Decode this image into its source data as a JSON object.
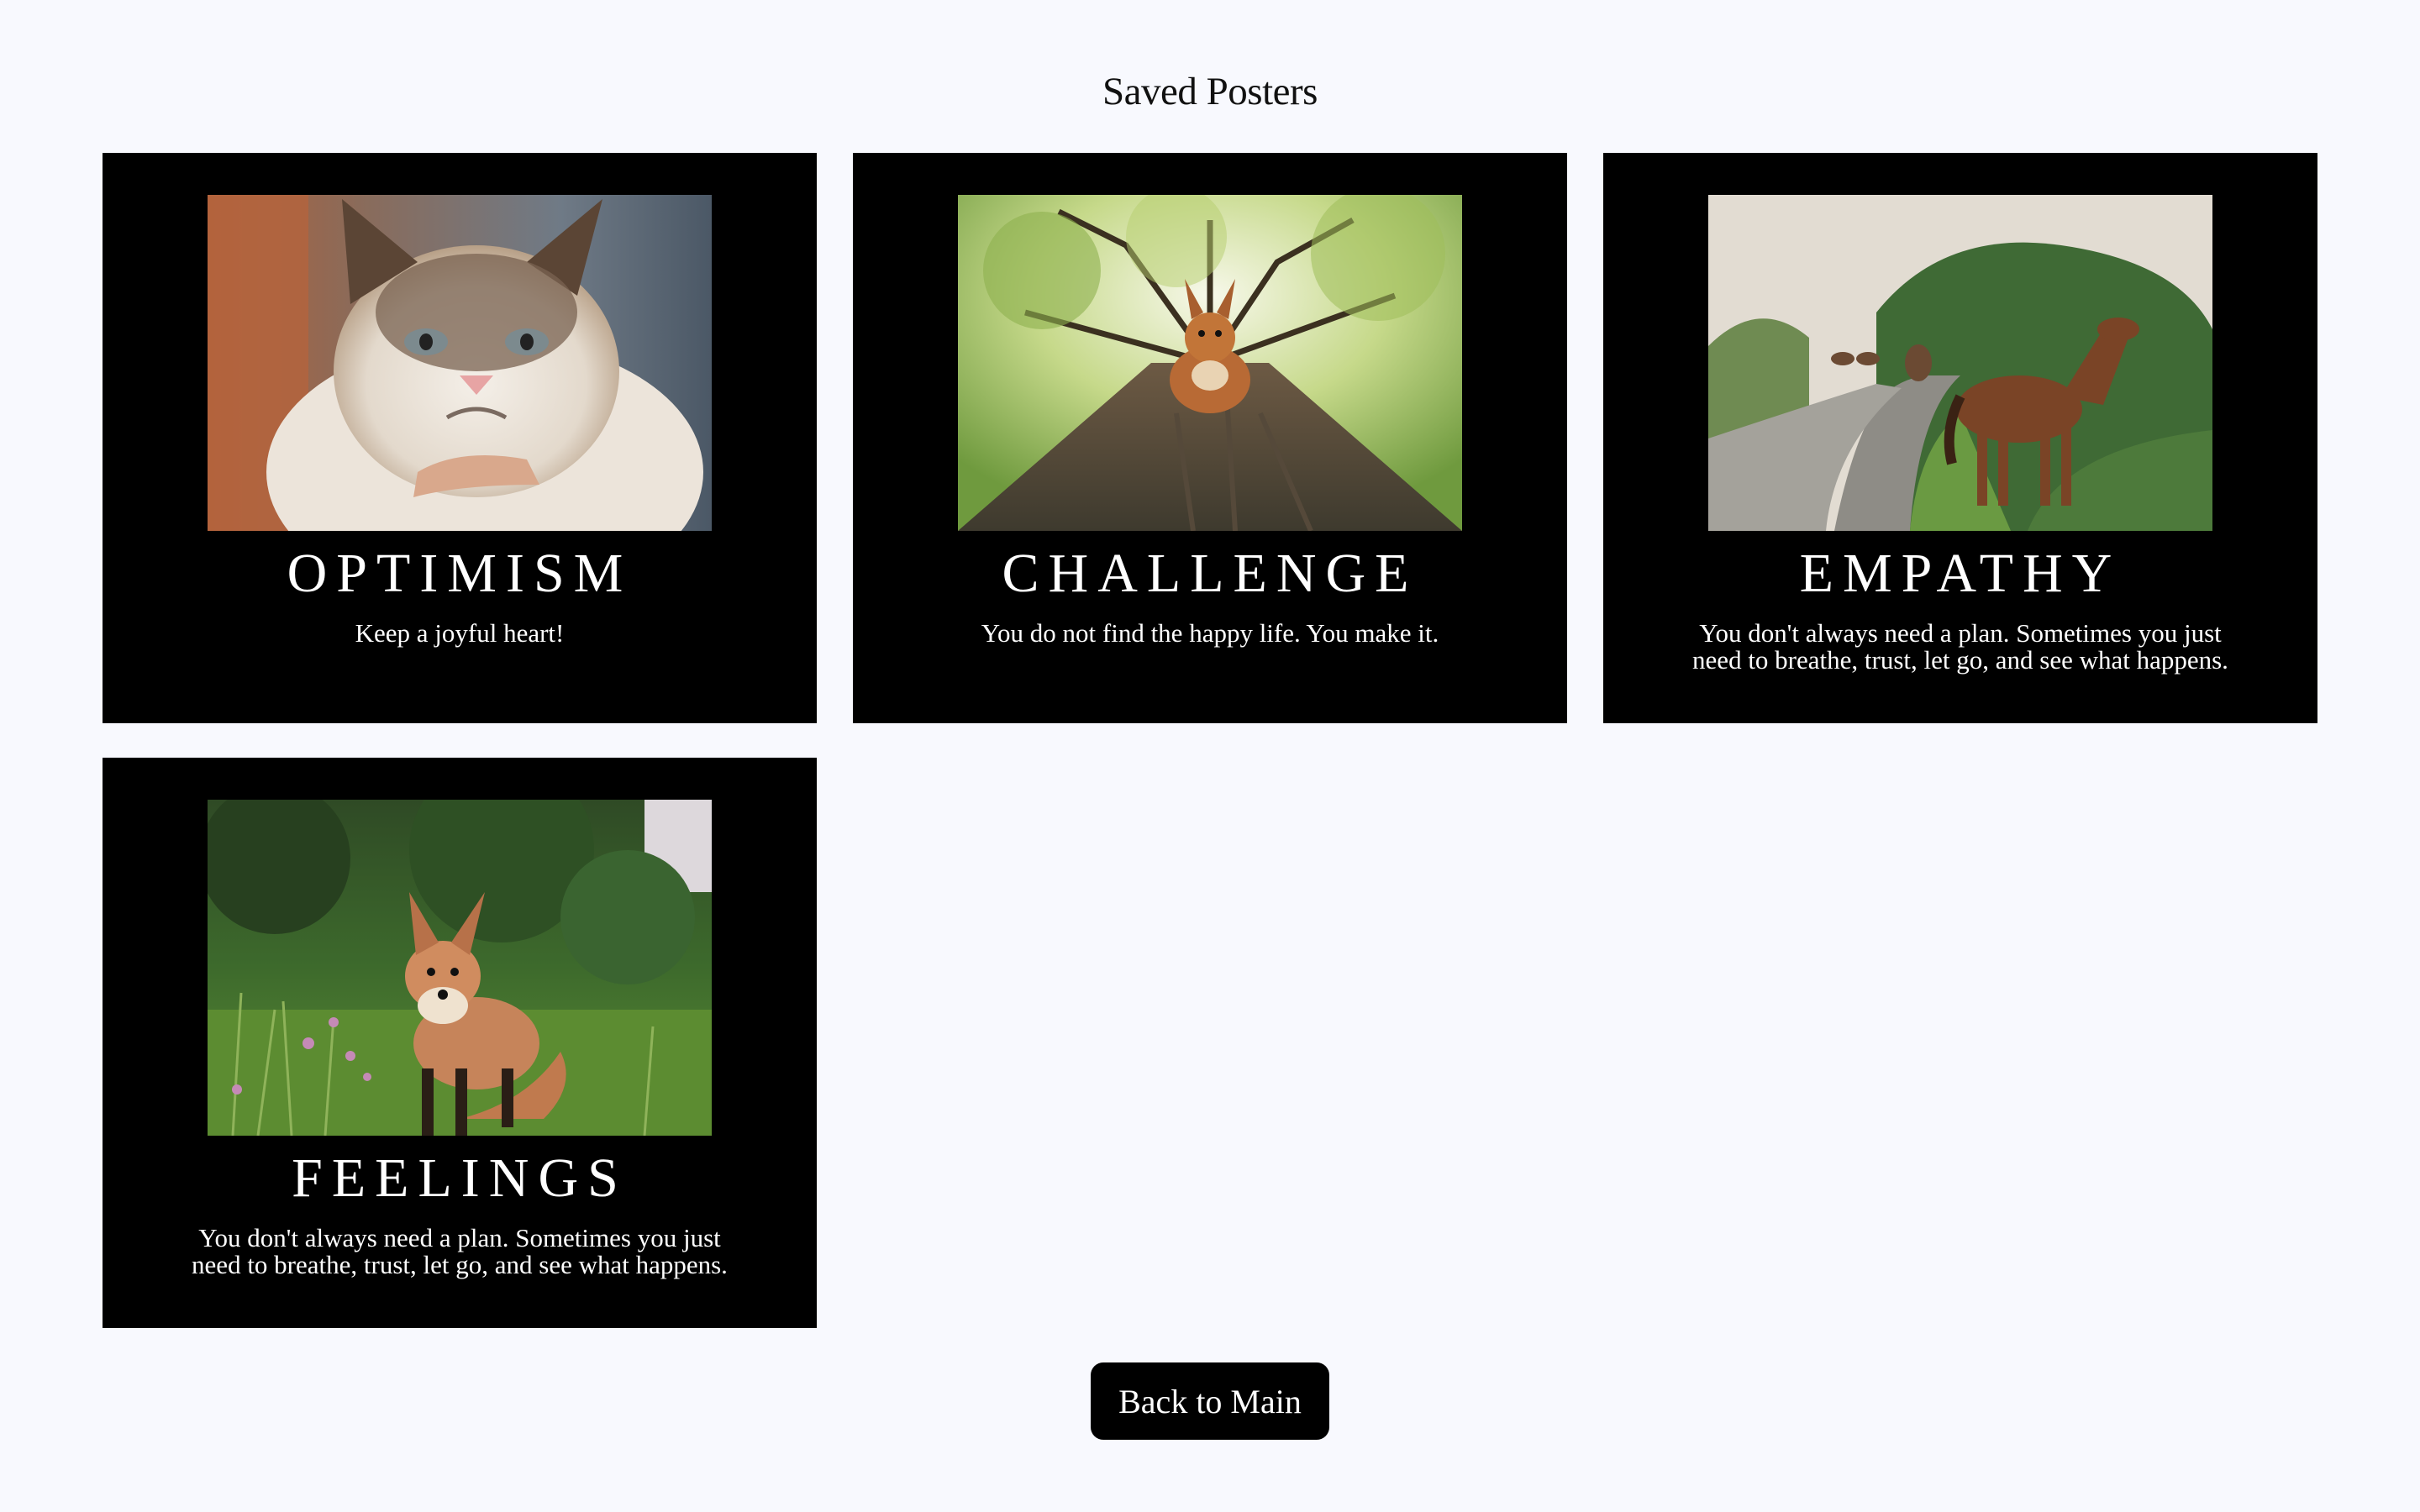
{
  "page": {
    "title": "Saved Posters"
  },
  "posters": [
    {
      "image": "grumpy-cat-photo",
      "title": "OPTIMISM",
      "quote": "Keep a joyful heart!"
    },
    {
      "image": "squirrel-on-tree-photo",
      "title": "CHALLENGE",
      "quote": "You do not find the happy life. You make it."
    },
    {
      "image": "horses-on-road-photo",
      "title": "EMPATHY",
      "quote": "You don't always need a plan. Sometimes you just need to breathe, trust, let go, and see what happens."
    },
    {
      "image": "fox-in-grass-photo",
      "title": "FEELINGS",
      "quote": "You don't always need a plan. Sometimes you just need to breathe, trust, let go, and see what happens."
    }
  ],
  "actions": {
    "back_label": "Back to Main"
  },
  "colors": {
    "background": "#f8f9fe",
    "poster_bg": "#000000",
    "text_on_poster": "#ffffff",
    "button_bg": "#000000"
  }
}
